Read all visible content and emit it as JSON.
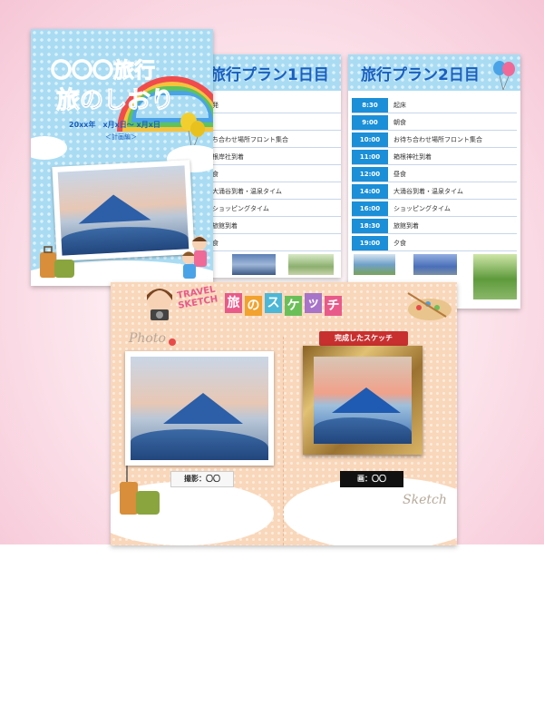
{
  "cover": {
    "title_line1": "〇〇〇旅行",
    "title_line2": "旅のしおり",
    "dates": "20xx年　x月x日～ x月x日",
    "subtitle": "＜計画編＞"
  },
  "day1": {
    "title": "旅行プラン1日目",
    "rows": [
      {
        "activity": "発"
      },
      {
        "activity": ""
      },
      {
        "activity": "ち合わせ場所フロント集合"
      },
      {
        "activity": "根岸社到着"
      },
      {
        "activity": "食"
      },
      {
        "activity": "大涌谷到着・温泉タイム"
      },
      {
        "activity": "ショッピングタイム"
      },
      {
        "activity": "旅館到着"
      },
      {
        "activity": "食"
      }
    ]
  },
  "day2": {
    "title": "旅行プラン2日目",
    "rows": [
      {
        "time": "8:30",
        "activity": "起床"
      },
      {
        "time": "9:00",
        "activity": "朝食"
      },
      {
        "time": "10:00",
        "activity": "お待ち合わせ場所フロント集合"
      },
      {
        "time": "11:00",
        "activity": "箱根神社到着"
      },
      {
        "time": "12:00",
        "activity": "昼食"
      },
      {
        "time": "14:00",
        "activity": "大涌谷到着・温泉タイム"
      },
      {
        "time": "16:00",
        "activity": "ショッピングタイム"
      },
      {
        "time": "18:30",
        "activity": "旅館到着"
      },
      {
        "time": "19:00",
        "activity": "夕食"
      }
    ]
  },
  "sketch": {
    "badge_line1": "TRAVEL",
    "badge_line2": "SKETCH",
    "title_chars": [
      "旅",
      "の",
      "ス",
      "ケ",
      "ッ",
      "チ"
    ],
    "title_colors": [
      "#e85a8a",
      "#f2a22e",
      "#4cb7d6",
      "#6bbf59",
      "#a774c9",
      "#e85a8a"
    ],
    "photo_script": "Photo",
    "sketch_script": "Sketch",
    "ribbon": "完成したスケッチ",
    "photo_caption": "撮影：〇〇",
    "sketch_caption": "画：〇〇"
  },
  "colors": {
    "accent_blue": "#1a5fc1",
    "time_blue": "#1b8fd8",
    "sky": "#a9dcf3",
    "peach": "#f9d7ba",
    "pink_bg": "#f6c6d6"
  }
}
